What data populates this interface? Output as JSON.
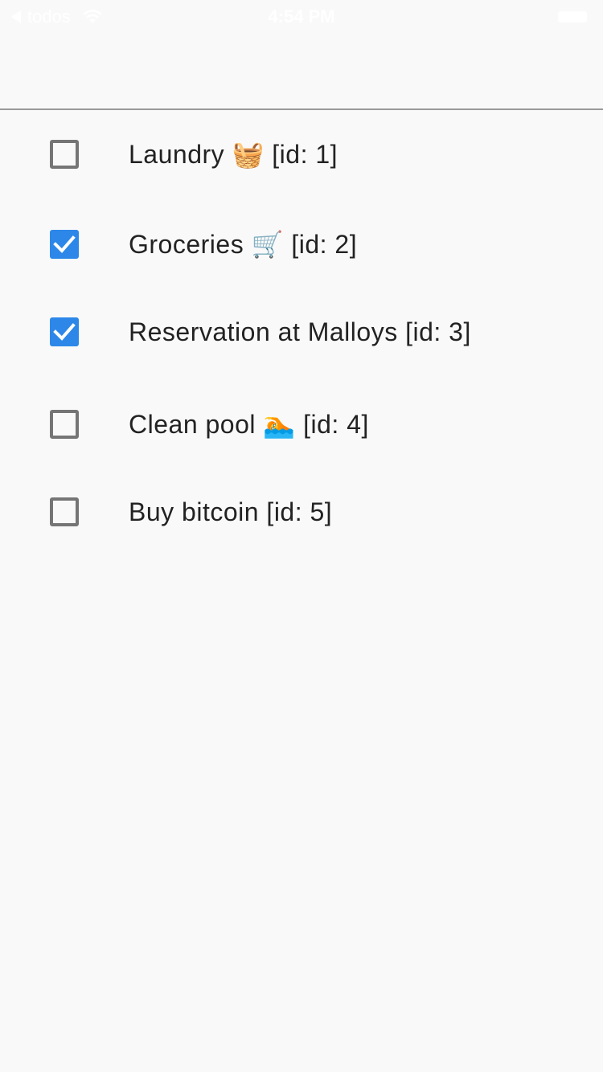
{
  "status_bar": {
    "carrier": "todos",
    "time": "4:54 PM"
  },
  "todos": [
    {
      "label": "Laundry 🧺 [id: 1]",
      "checked": false
    },
    {
      "label": "Groceries 🛒 [id: 2]",
      "checked": true
    },
    {
      "label": "Reservation at Malloys [id: 3]",
      "checked": true
    },
    {
      "label": "Clean pool 🏊 [id: 4]",
      "checked": false
    },
    {
      "label": "Buy bitcoin [id: 5]",
      "checked": false
    }
  ],
  "colors": {
    "background": "#f9f9f9",
    "checkbox_checked": "#2c87e8",
    "checkbox_unchecked_border": "#757575",
    "divider": "#9a9a9a"
  }
}
